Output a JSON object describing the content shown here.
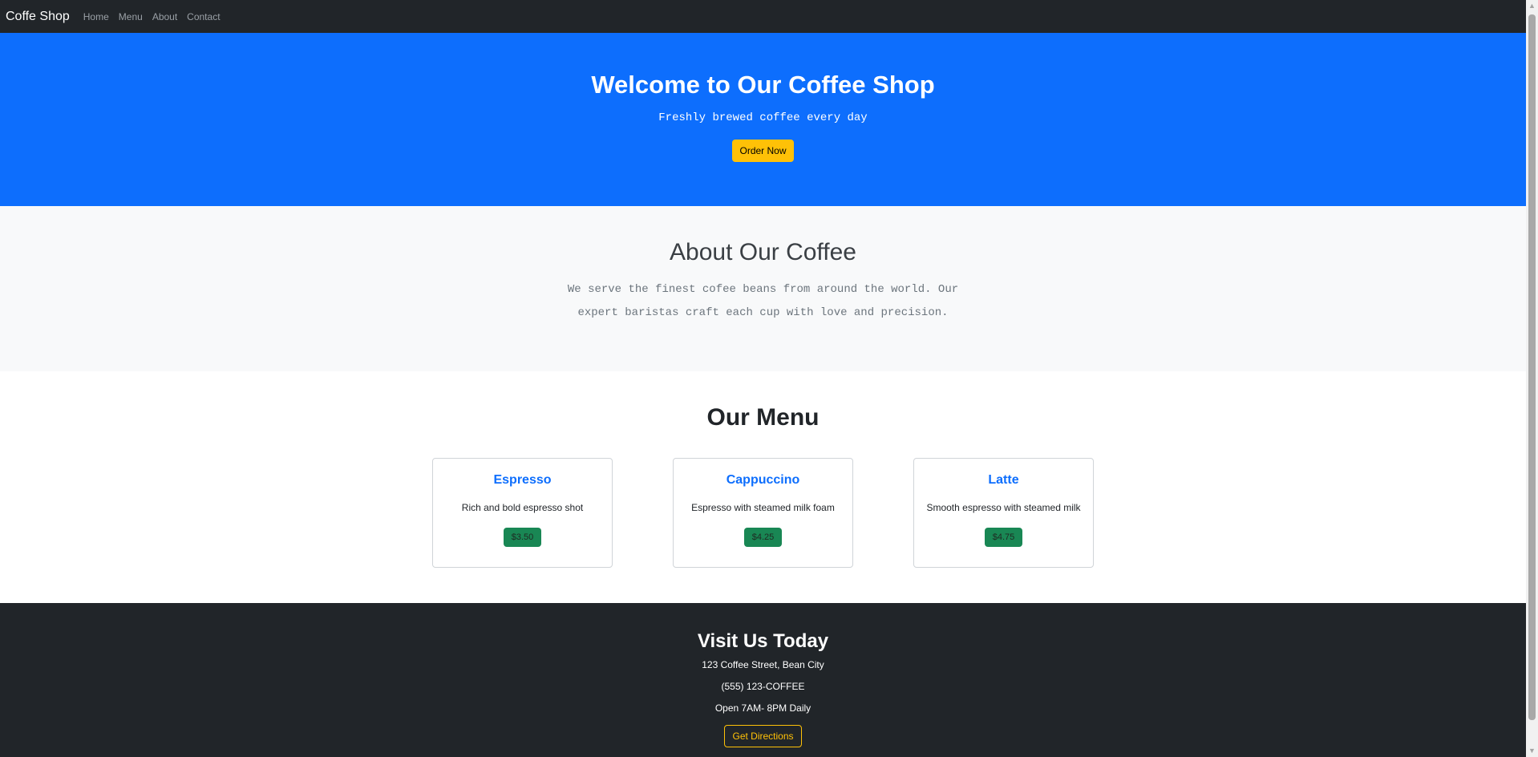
{
  "navbar": {
    "brand": "Coffe Shop",
    "links": [
      "Home",
      "Menu",
      "About",
      "Contact"
    ]
  },
  "hero": {
    "title": "Welcome to Our Coffee Shop",
    "subtitle": "Freshly brewed coffee every day",
    "cta_label": "Order Now"
  },
  "about": {
    "title": "About Our Coffee",
    "text": "We serve the finest cofee beans from around the world. Our expert baristas craft each cup with love and precision."
  },
  "menu": {
    "title": "Our Menu",
    "items": [
      {
        "name": "Espresso",
        "description": "Rich and bold espresso shot",
        "price": "$3.50"
      },
      {
        "name": "Cappuccino",
        "description": "Espresso with steamed milk foam",
        "price": "$4.25"
      },
      {
        "name": "Latte",
        "description": "Smooth espresso with steamed milk",
        "price": "$4.75"
      }
    ]
  },
  "footer": {
    "title": "Visit Us Today",
    "address": "123 Coffee Street, Bean City",
    "phone": "(555) 123-COFFEE",
    "hours": "Open 7AM- 8PM Daily",
    "cta_label": "Get Directions"
  },
  "scrollbar": {
    "up_icon": "▲",
    "down_icon": "▼"
  },
  "colors": {
    "navbar_bg": "#212529",
    "hero_bg": "#0d6efd",
    "accent_yellow": "#ffc107",
    "price_green": "#198754",
    "about_bg": "#f8f9fa"
  }
}
